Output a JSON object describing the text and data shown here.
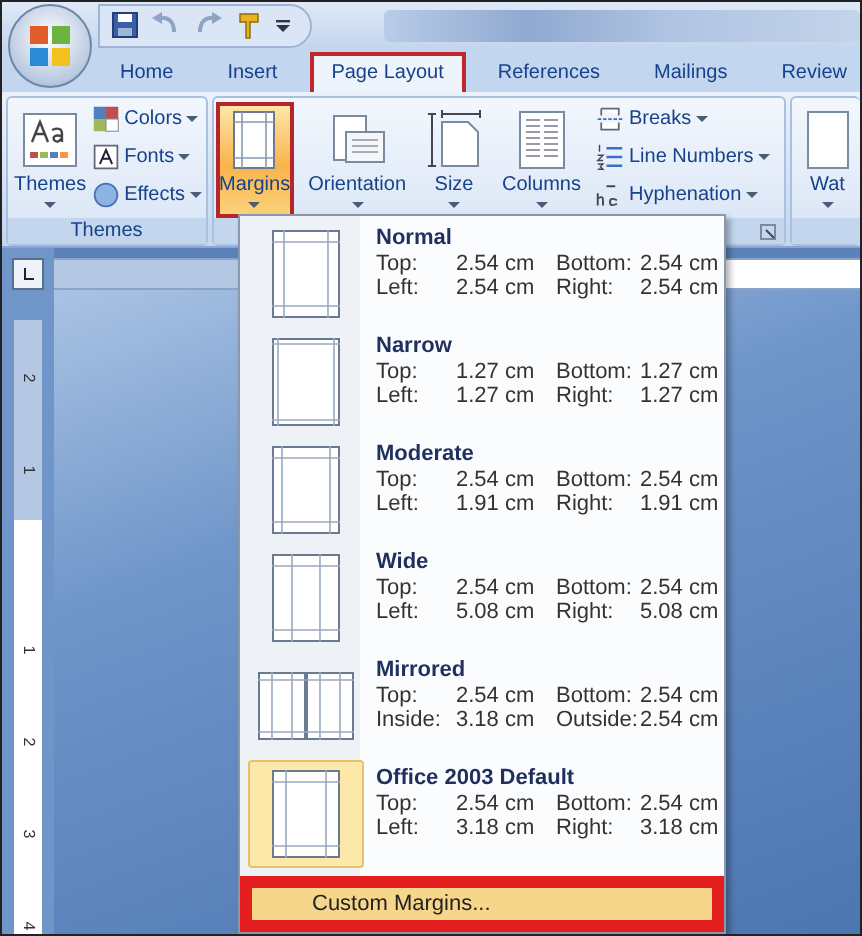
{
  "tabs": [
    {
      "label": "Home",
      "selected": false
    },
    {
      "label": "Insert",
      "selected": false
    },
    {
      "label": "Page Layout",
      "selected": true
    },
    {
      "label": "References",
      "selected": false
    },
    {
      "label": "Mailings",
      "selected": false
    },
    {
      "label": "Review",
      "selected": false
    }
  ],
  "ribbon": {
    "groups": [
      {
        "label": "Themes",
        "large": [
          {
            "label": "Themes",
            "selected": false
          }
        ],
        "small": [
          {
            "label": "Colors"
          },
          {
            "label": "Fonts"
          },
          {
            "label": "Effects"
          }
        ]
      },
      {
        "large": [
          {
            "label": "Margins",
            "selected": true
          },
          {
            "label": "Orientation",
            "selected": false
          },
          {
            "label": "Size",
            "selected": false
          },
          {
            "label": "Columns",
            "selected": false
          }
        ],
        "small": [
          {
            "label": "Breaks"
          },
          {
            "label": "Line Numbers"
          },
          {
            "label": "Hyphenation"
          }
        ]
      },
      {
        "large": [
          {
            "label": "Wat",
            "selected": false
          }
        ]
      }
    ]
  },
  "ruler": {
    "labels": [
      "2",
      "1",
      "1",
      "2",
      "3",
      "4"
    ]
  },
  "margins_menu": {
    "options": [
      {
        "name": "Normal",
        "kind": "normal",
        "selected": false,
        "rows": [
          [
            "Top:",
            "2.54 cm",
            "Bottom:",
            "2.54 cm"
          ],
          [
            "Left:",
            "2.54 cm",
            "Right:",
            "2.54 cm"
          ]
        ]
      },
      {
        "name": "Narrow",
        "kind": "narrow",
        "selected": false,
        "rows": [
          [
            "Top:",
            "1.27 cm",
            "Bottom:",
            "1.27 cm"
          ],
          [
            "Left:",
            "1.27 cm",
            "Right:",
            "1.27 cm"
          ]
        ]
      },
      {
        "name": "Moderate",
        "kind": "moderate",
        "selected": false,
        "rows": [
          [
            "Top:",
            "2.54 cm",
            "Bottom:",
            "2.54 cm"
          ],
          [
            "Left:",
            "1.91 cm",
            "Right:",
            "1.91 cm"
          ]
        ]
      },
      {
        "name": "Wide",
        "kind": "wide",
        "selected": false,
        "rows": [
          [
            "Top:",
            "2.54 cm",
            "Bottom:",
            "2.54 cm"
          ],
          [
            "Left:",
            "5.08 cm",
            "Right:",
            "5.08 cm"
          ]
        ]
      },
      {
        "name": "Mirrored",
        "kind": "mirrored",
        "selected": false,
        "rows": [
          [
            "Top:",
            "2.54 cm",
            "Bottom:",
            "2.54 cm"
          ],
          [
            "Inside:",
            "3.18 cm",
            "Outside:",
            "2.54 cm"
          ]
        ]
      },
      {
        "name": "Office 2003 Default",
        "kind": "office2003",
        "selected": true,
        "rows": [
          [
            "Top:",
            "2.54 cm",
            "Bottom:",
            "2.54 cm"
          ],
          [
            "Left:",
            "3.18 cm",
            "Right:",
            "3.18 cm"
          ]
        ]
      }
    ],
    "footer": {
      "label": "Custom Margins...",
      "highlighted": true
    }
  }
}
